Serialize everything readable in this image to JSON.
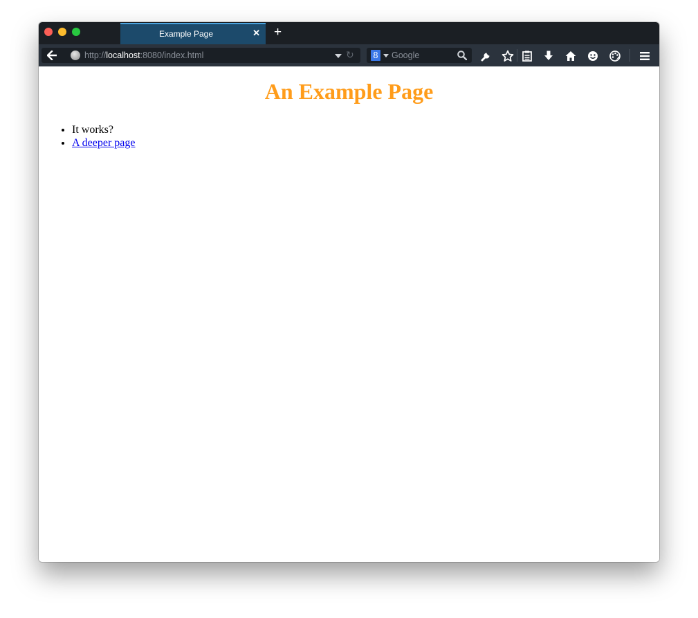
{
  "browser": {
    "tab": {
      "title": "Example Page",
      "close_glyph": "✕"
    },
    "new_tab_glyph": "+",
    "url": {
      "scheme": "http://",
      "host": "localhost",
      "rest": ":8080/index.html"
    },
    "search": {
      "engine_icon": "8",
      "placeholder": "Google"
    },
    "toolbar_icons": [
      "wrench-icon",
      "star-icon",
      "reading-list-icon",
      "download-icon",
      "home-icon",
      "smiley-icon",
      "palette-icon",
      "hamburger-menu-icon"
    ]
  },
  "page": {
    "title": "An Example Page",
    "title_color": "#ff9c1a",
    "items": [
      "It works?"
    ],
    "link_text": "A deeper page",
    "link_color": "#0000ee"
  }
}
